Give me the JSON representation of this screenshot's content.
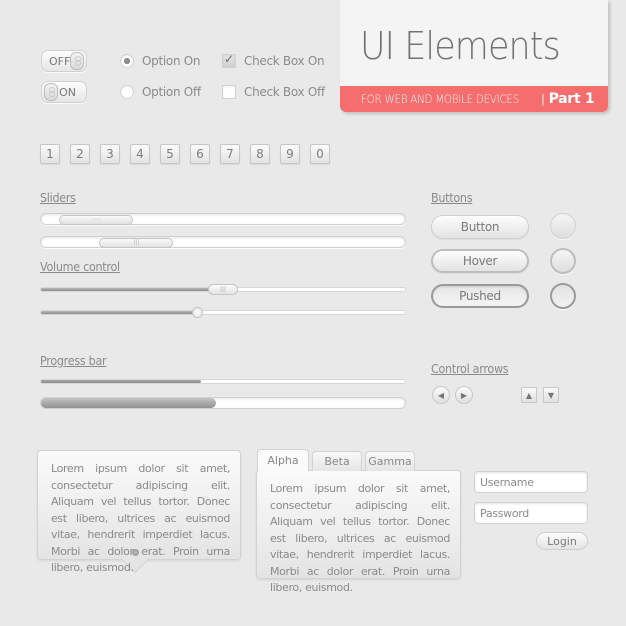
{
  "header": {
    "title": "UI Elements",
    "subtitle": "FOR WEB AND MOBILE DEVICES",
    "separator": "|",
    "part": "Part 1",
    "accent_color": "#f66d6e"
  },
  "toggles": [
    {
      "label": "OFF",
      "state": "off"
    },
    {
      "label": "ON",
      "state": "on"
    }
  ],
  "radios": [
    {
      "label": "Option On",
      "checked": true
    },
    {
      "label": "Option Off",
      "checked": false
    }
  ],
  "checkboxes": [
    {
      "label": "Check Box On",
      "checked": true
    },
    {
      "label": "Check Box Off",
      "checked": false
    }
  ],
  "number_keys": [
    "1",
    "2",
    "3",
    "4",
    "5",
    "6",
    "7",
    "8",
    "9",
    "0"
  ],
  "sliders": {
    "label": "Sliders",
    "items": [
      {
        "thumb_position": 0.05,
        "thumb_glyph": "◦◦◦"
      },
      {
        "thumb_position": 0.16,
        "thumb_glyph": "|||"
      }
    ]
  },
  "volume": {
    "label": "Volume control",
    "items": [
      {
        "value": 0.5,
        "thumb": "pill",
        "thumb_glyph": "|||"
      },
      {
        "value": 0.43,
        "thumb": "dot"
      }
    ]
  },
  "progress": {
    "label": "Progress bar",
    "items": [
      {
        "value": 0.44,
        "style": "thin"
      },
      {
        "value": 0.48,
        "style": "thick"
      }
    ]
  },
  "buttons": {
    "label": "Buttons",
    "items": [
      {
        "label": "Button",
        "state": "normal"
      },
      {
        "label": "Hover",
        "state": "hover"
      },
      {
        "label": "Pushed",
        "state": "pushed"
      }
    ]
  },
  "control_arrows": {
    "label": "Control arrows",
    "items": [
      {
        "icon": "arrow-left-icon",
        "glyph": "◀"
      },
      {
        "icon": "arrow-right-icon",
        "glyph": "▶"
      },
      {
        "icon": "arrow-up-icon",
        "glyph": "▲"
      },
      {
        "icon": "arrow-down-icon",
        "glyph": "▼"
      }
    ]
  },
  "tooltip": {
    "text": "Lorem ipsum dolor sit amet, consectetur adipiscing elit. Aliquam vel tellus tortor. Donec est libero, ultrices ac euismod vitae, hendrerit imperdiet lacus. Morbi ac dolor erat. Proin urna libero, euismod."
  },
  "tabs": {
    "items": [
      "Alpha",
      "Beta",
      "Gamma"
    ],
    "active": "Alpha",
    "content": "Lorem ipsum dolor sit amet, consectetur adipiscing elit. Aliquam vel tellus tortor. Donec est libero, ultrices ac euismod vitae, hendrerit imperdiet lacus. Morbi ac dolor erat. Proin urna libero, euismod."
  },
  "login": {
    "username_placeholder": "Username",
    "password_placeholder": "Password",
    "button_label": "Login"
  }
}
